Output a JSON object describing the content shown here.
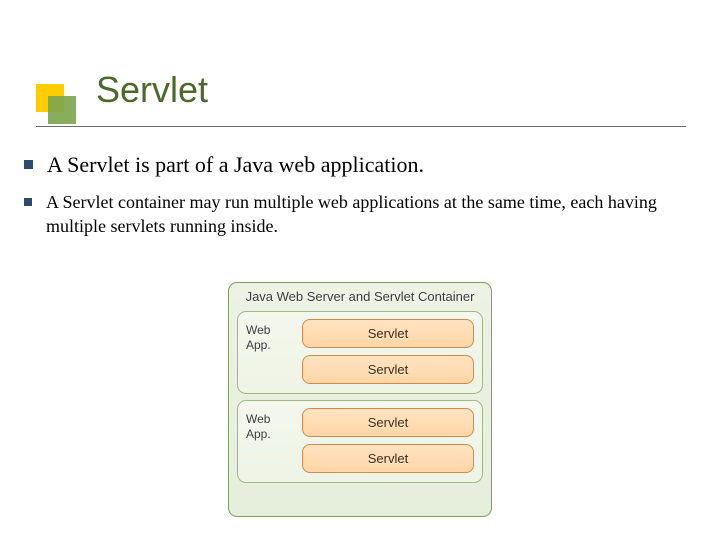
{
  "title": "Servlet",
  "bullets": [
    "A Servlet is part of a Java web application.",
    "A Servlet container may run multiple web applications at the same time, each having multiple servlets running inside."
  ],
  "diagram": {
    "outer_title": "Java Web Server and Servlet Container",
    "webapps": [
      {
        "label": "Web App.",
        "servlets": [
          "Servlet",
          "Servlet"
        ]
      },
      {
        "label": "Web App.",
        "servlets": [
          "Servlet",
          "Servlet"
        ]
      }
    ]
  }
}
